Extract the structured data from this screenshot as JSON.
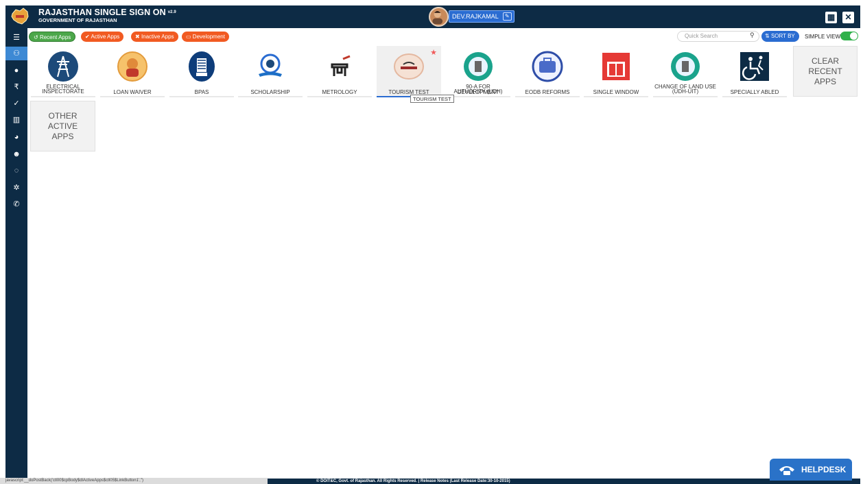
{
  "header": {
    "brand_title": "RAJASTHAN SINGLE SIGN ON",
    "brand_version": "v2.9",
    "brand_subtitle": "GOVERNMENT OF RAJASTHAN",
    "user_name": "DEV.RAJKAMAL",
    "edit_icon": "edit-icon",
    "grid_icon": "grid-icon",
    "close_icon": "close-icon"
  },
  "sidebar": {
    "items": [
      {
        "icon": "menu-toggle-icon",
        "glyph": "☰"
      },
      {
        "icon": "users-plus-icon",
        "glyph": "⚇"
      },
      {
        "icon": "user-icon",
        "glyph": "●"
      },
      {
        "icon": "rupee-icon",
        "glyph": "₹"
      },
      {
        "icon": "check-circle-icon",
        "glyph": "✓"
      },
      {
        "icon": "bar-chart-icon",
        "glyph": "▥"
      },
      {
        "icon": "pie-chart-icon",
        "glyph": "◕"
      },
      {
        "icon": "group-icon",
        "glyph": "☻"
      },
      {
        "icon": "chat-icon",
        "glyph": "◌"
      },
      {
        "icon": "gear-icon",
        "glyph": "✲"
      },
      {
        "icon": "phone-icon",
        "glyph": "✆"
      }
    ]
  },
  "toolbar": {
    "tabs": [
      {
        "label": "Recent Apps",
        "glyph": "↺"
      },
      {
        "label": "Active Apps",
        "glyph": "✔"
      },
      {
        "label": "Inactive Apps",
        "glyph": "✖"
      },
      {
        "label": "Development",
        "glyph": "▭"
      }
    ],
    "search_placeholder": "Quick Search",
    "sort_label": "SORT BY",
    "simple_view_label": "SIMPLE VIEW",
    "simple_view_on": true
  },
  "apps": [
    {
      "label_line1": "ELECTRICAL",
      "label_line2": "INSPECTORATE",
      "icon": "electrical-tower-icon"
    },
    {
      "label_line1": "LOAN WAIVER",
      "label_line2": "",
      "icon": "loan-waiver-logo"
    },
    {
      "label_line1": "BPAS",
      "label_line2": "",
      "icon": "bpas-building-icon"
    },
    {
      "label_line1": "SCHOLARSHIP",
      "label_line2": "",
      "icon": "scholarship-emblem-icon"
    },
    {
      "label_line1": "METROLOGY",
      "label_line2": "",
      "icon": "metrology-scale-icon"
    },
    {
      "label_line1": "TOURISM TEST",
      "label_line2": "",
      "icon": "rajasthan-tourism-logo",
      "selected": true,
      "starred": true
    },
    {
      "label_line1": "90-A FOR DEVELOPMENT",
      "label_line2": "AUTHORITY (UDH)",
      "icon": "udh-emblem-icon"
    },
    {
      "label_line1": "EODB REFORMS",
      "label_line2": "",
      "icon": "eodb-briefcase-icon"
    },
    {
      "label_line1": "SINGLE WINDOW",
      "label_line2": "",
      "icon": "single-window-icon"
    },
    {
      "label_line1": "CHANGE OF LAND USE",
      "label_line2": "(UDH-UIT)",
      "icon": "land-use-emblem-icon"
    },
    {
      "label_line1": "SPECIALLY ABLED",
      "label_line2": "",
      "icon": "specially-abled-icon"
    }
  ],
  "tooltip": "TOURISM TEST",
  "clear_recent": {
    "line1": "CLEAR",
    "line2": "RECENT",
    "line3": "APPS"
  },
  "other_active": {
    "line1": "OTHER",
    "line2": "ACTIVE",
    "line3": "APPS"
  },
  "footer": {
    "status_text": "javascript:__doPostBack('ctl00$cpBody$dlActiveApps$ctl05$LinkButton1','')",
    "copyright": "© DOIT&C, Govt. of Rajasthan. All Rights Reserved.  |  Release Notes (Last Release Date:30-10-2015)"
  },
  "helpdesk": {
    "label": "HELPDESK",
    "icon": "helpdesk-phone-icon"
  },
  "colors": {
    "navy": "#0d2b45",
    "accent_blue": "#2a6cd1",
    "green": "#4ca74a",
    "orange": "#f15a22",
    "toggle_green": "#2fb14a"
  }
}
